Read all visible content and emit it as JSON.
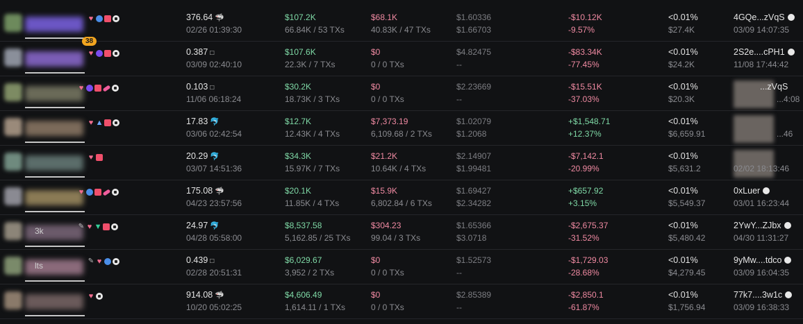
{
  "rows": [
    {
      "balance": "376.64",
      "balance_icon": "shark",
      "time": "02/26 01:39:30",
      "bought": "$107.2K",
      "bought_sub": "66.84K / 53 TXs",
      "sold": "$68.1K",
      "sold_sub": "40.83K / 47 TXs",
      "price1": "$1.60336",
      "price2": "$1.66703",
      "pnl": "-$10.12K",
      "pnl_pct": "-9.57%",
      "pnl_dir": "neg",
      "share": "<0.01%",
      "value": "$27.4K",
      "addr": "4GQe...zVqS",
      "addr_time": "03/09 14:07:35",
      "level": "38",
      "name_text": "",
      "avatar_color": "#6d8a5c",
      "name_color": "#6b56c4",
      "badges": [
        "heart",
        "blue",
        "stack",
        "circle"
      ]
    },
    {
      "balance": "0.387",
      "balance_icon": "fish",
      "time": "03/09 02:40:10",
      "bought": "$107.6K",
      "bought_sub": "22.3K / 7 TXs",
      "sold": "$0",
      "sold_sub": "0 / 0 TXs",
      "price1": "$4.82475",
      "price2": "--",
      "pnl": "-$83.34K",
      "pnl_pct": "-77.45%",
      "pnl_dir": "neg",
      "share": "<0.01%",
      "value": "$24.2K",
      "addr": "2S2e....cPH1",
      "addr_time": "11/08 17:44:42",
      "level": "",
      "name_text": "",
      "avatar_color": "#8a8f9a",
      "name_color": "#7a5db5",
      "badges": [
        "heart",
        "purple",
        "stack",
        "circle"
      ]
    },
    {
      "balance": "0.103",
      "balance_icon": "fish",
      "time": "11/06 06:18:24",
      "bought": "$30.2K",
      "bought_sub": "18.73K / 3 TXs",
      "sold": "$0",
      "sold_sub": "0 / 0 TXs",
      "price1": "$2.23669",
      "price2": "--",
      "pnl": "-$15.51K",
      "pnl_pct": "-37.03%",
      "pnl_dir": "neg",
      "share": "<0.01%",
      "value": "$20.3K",
      "addr": "...zVqS",
      "addr_time": "...4:08",
      "level": "",
      "name_text": "",
      "avatar_color": "#7d8b63",
      "name_color": "#6a6a58",
      "badges": [
        "heart",
        "purple",
        "stack",
        "pill",
        "circle"
      ]
    },
    {
      "balance": "17.83",
      "balance_icon": "dolphin",
      "time": "03/06 02:42:54",
      "bought": "$12.7K",
      "bought_sub": "12.43K / 4 TXs",
      "sold": "$7,373.19",
      "sold_sub": "6,109.68 / 2 TXs",
      "price1": "$1.02079",
      "price2": "$1.2068",
      "pnl": "+$1,548.71",
      "pnl_pct": "+12.37%",
      "pnl_dir": "pos",
      "share": "<0.01%",
      "value": "$6,659.91",
      "addr": "",
      "addr_time": "...46",
      "level": "",
      "name_text": "",
      "avatar_color": "#9a8a7a",
      "name_color": "#7b6a5a",
      "badges": [
        "heart",
        "rocket",
        "stack",
        "circle"
      ]
    },
    {
      "balance": "20.29",
      "balance_icon": "dolphin",
      "time": "03/07 14:51:36",
      "bought": "$34.3K",
      "bought_sub": "15.97K / 7 TXs",
      "sold": "$21.2K",
      "sold_sub": "10.64K / 4 TXs",
      "price1": "$2.14907",
      "price2": "$1.99481",
      "pnl": "-$7,142.1",
      "pnl_pct": "-20.99%",
      "pnl_dir": "neg",
      "share": "<0.01%",
      "value": "$5,631.2",
      "addr": "",
      "addr_time": "02/02 18:13:46",
      "level": "",
      "name_text": "",
      "avatar_color": "#6f8a7e",
      "name_color": "#5b6d6a",
      "badges": [
        "heart",
        "stack"
      ]
    },
    {
      "balance": "175.08",
      "balance_icon": "shark",
      "time": "04/23 23:57:56",
      "bought": "$20.1K",
      "bought_sub": "11.85K / 4 TXs",
      "sold": "$15.9K",
      "sold_sub": "6,802.84 / 6 TXs",
      "price1": "$1.69427",
      "price2": "$2.34282",
      "pnl": "+$657.92",
      "pnl_pct": "+3.15%",
      "pnl_dir": "pos",
      "share": "<0.01%",
      "value": "$5,549.37",
      "addr": "0xLuer",
      "addr_time": "03/01 16:23:44",
      "level": "",
      "name_text": "",
      "avatar_color": "#8a8a92",
      "name_color": "#8a7a55",
      "badges": [
        "heart",
        "blue",
        "stack",
        "pill",
        "circle"
      ]
    },
    {
      "balance": "24.97",
      "balance_icon": "dolphin",
      "time": "04/28 05:58:00",
      "bought": "$8,537.58",
      "bought_sub": "5,162.85 / 25 TXs",
      "sold": "$304.23",
      "sold_sub": "99.04 / 3 TXs",
      "price1": "$1.65366",
      "price2": "$3.0718",
      "pnl": "-$2,675.37",
      "pnl_pct": "-31.52%",
      "pnl_dir": "neg",
      "share": "<0.01%",
      "value": "$5,480.42",
      "addr": "2YwY...ZJbx",
      "addr_time": "04/30 11:31:27",
      "level": "",
      "name_text": "3k",
      "avatar_color": "#8c8578",
      "name_color": "#6b5a6a",
      "badges": [
        "pen",
        "heart",
        "tri",
        "stack",
        "circle"
      ]
    },
    {
      "balance": "0.439",
      "balance_icon": "fish",
      "time": "02/28 20:51:31",
      "bought": "$6,029.67",
      "bought_sub": "3,952 / 2 TXs",
      "sold": "$0",
      "sold_sub": "0 / 0 TXs",
      "price1": "$1.52573",
      "price2": "--",
      "pnl": "-$1,729.03",
      "pnl_pct": "-28.68%",
      "pnl_dir": "neg",
      "share": "<0.01%",
      "value": "$4,279.45",
      "addr": "9yMw....tdco",
      "addr_time": "03/09 16:04:35",
      "level": "",
      "name_text": "lts",
      "avatar_color": "#7a8a6a",
      "name_color": "#8a6a7a",
      "badges": [
        "pen",
        "heart",
        "blue",
        "circle"
      ]
    },
    {
      "balance": "914.08",
      "balance_icon": "shark",
      "time": "10/20 05:02:25",
      "bought": "$4,606.49",
      "bought_sub": "1,614.11 / 1 TXs",
      "sold": "$0",
      "sold_sub": "0 / 0 TXs",
      "price1": "$2.85389",
      "price2": "--",
      "pnl": "-$2,850.1",
      "pnl_pct": "-61.87%",
      "pnl_dir": "neg",
      "share": "<0.01%",
      "value": "$1,756.94",
      "addr": "77k7....3w1c",
      "addr_time": "03/09 16:38:33",
      "level": "",
      "name_text": "",
      "avatar_color": "#8a7a6a",
      "name_color": "#6a5a5a",
      "badges": [
        "heart",
        "circle"
      ]
    }
  ]
}
